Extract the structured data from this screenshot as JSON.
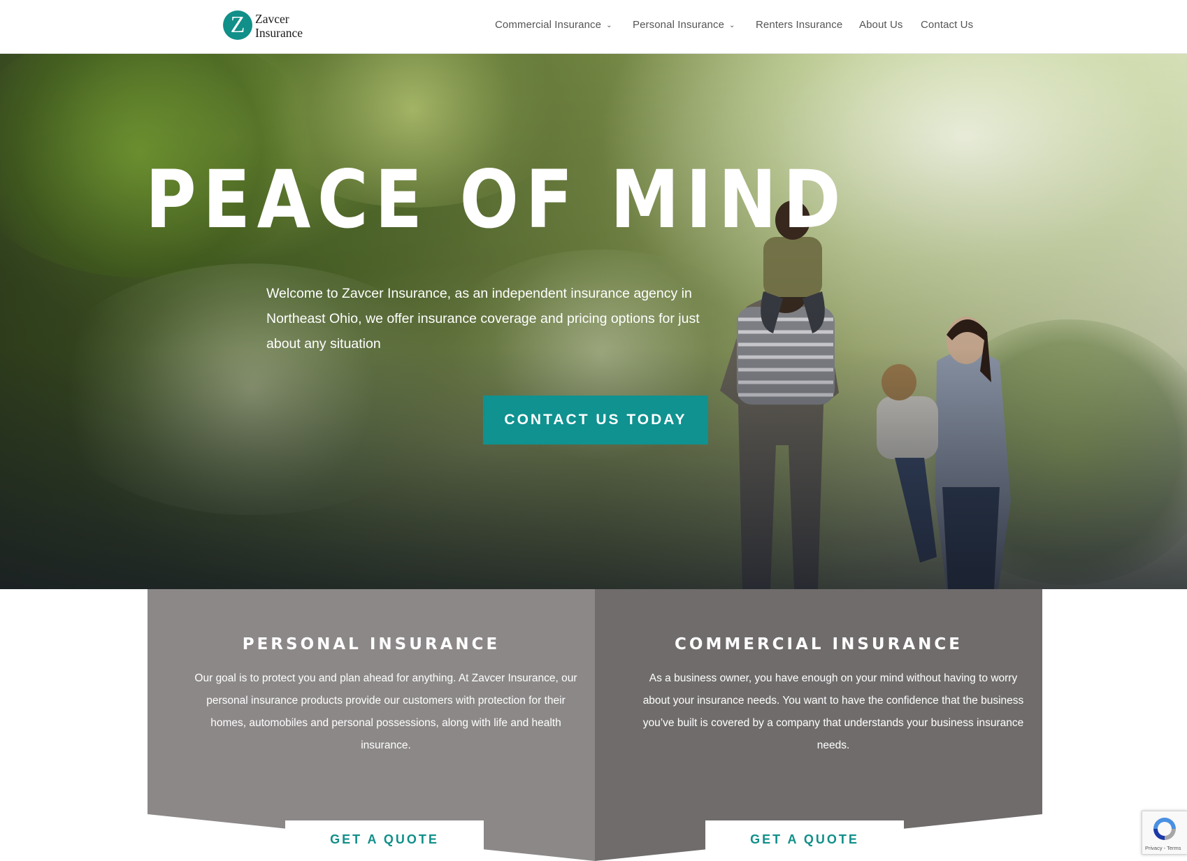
{
  "header": {
    "logo": {
      "letter": "Z",
      "line1": "Zavcer",
      "line2": "Insurance"
    },
    "nav": [
      {
        "label": "Commercial Insurance",
        "has_dropdown": true
      },
      {
        "label": "Personal Insurance",
        "has_dropdown": true
      },
      {
        "label": "Renters Insurance",
        "has_dropdown": false
      },
      {
        "label": "About Us",
        "has_dropdown": false
      },
      {
        "label": "Contact Us",
        "has_dropdown": false
      }
    ]
  },
  "hero": {
    "title": "PEACE OF MIND",
    "text": "Welcome to Zavcer Insurance, as an independent insurance agency in Northeast Ohio, we offer insurance coverage and pricing options for just about any situation",
    "cta_label": "CONTACT US TODAY"
  },
  "cards": [
    {
      "title": "PERSONAL INSURANCE",
      "text": "Our goal is to protect you and plan ahead for anything. At Zavcer Insurance, our personal insurance products provide our customers with protection for their homes, automobiles and personal possessions, along with life and health insurance.",
      "button_label": "GET A QUOTE"
    },
    {
      "title": "COMMERCIAL INSURANCE",
      "text": "As a business owner, you have enough on your mind without having to worry about your insurance needs. You want to have the confidence that the business you’ve built is covered by a company that understands your business insurance needs.",
      "button_label": "GET A QUOTE"
    }
  ],
  "recaptcha": {
    "links": "Privacy - Terms"
  },
  "colors": {
    "accent": "#118f89",
    "card_personal": "#8c8888",
    "card_commercial": "#706c6c",
    "nav_text": "#555555"
  },
  "icons": {
    "dropdown": "chevron-down-icon",
    "recaptcha": "recaptcha-icon"
  }
}
